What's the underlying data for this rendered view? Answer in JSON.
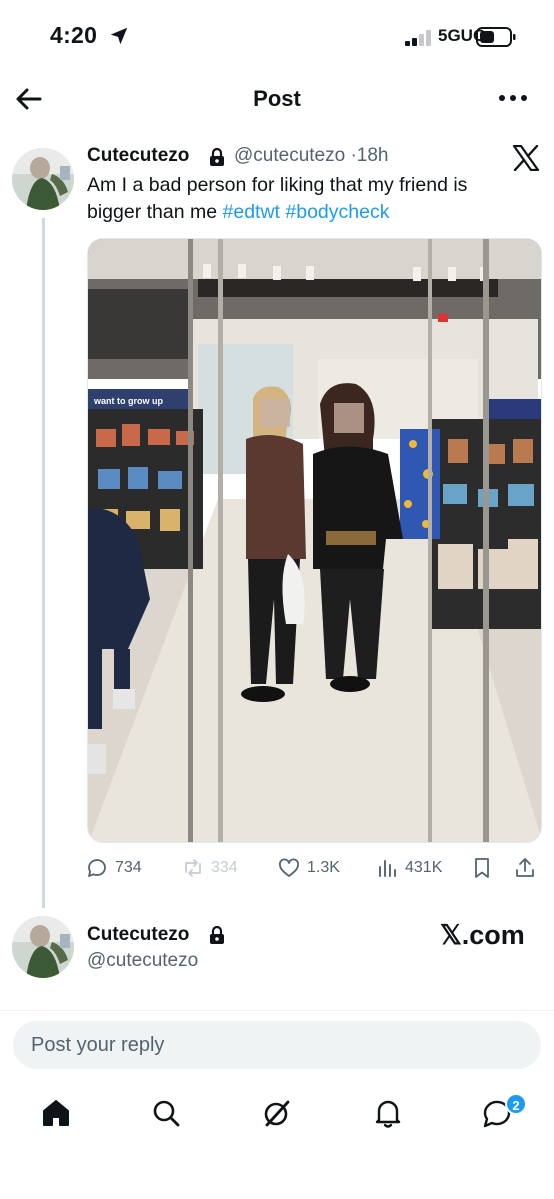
{
  "status_bar": {
    "time": "4:20",
    "network": "5GUC"
  },
  "header": {
    "title": "Post"
  },
  "tweet": {
    "display_name": "Cutecutezo",
    "handle": "@cutecutezo",
    "separator": "·",
    "time_ago": "18h",
    "text_plain": "Am I a bad person for liking that my friend is bigger than me",
    "hashtags": [
      "#edtwt",
      "#bodycheck"
    ],
    "photo_sign_text": "want to grow up",
    "stats": {
      "replies": "734",
      "reposts": "334",
      "likes": "1.3K",
      "views": "431K"
    }
  },
  "profile_card": {
    "display_name": "Cutecutezo",
    "handle": "@cutecutezo",
    "brand": "𝕏.com"
  },
  "reply": {
    "placeholder": "Post your reply"
  },
  "tabbar": {
    "notifications_badge": "2"
  },
  "colors": {
    "accent": "#1d9bf0",
    "text": "#0f1419",
    "muted": "#536471"
  }
}
